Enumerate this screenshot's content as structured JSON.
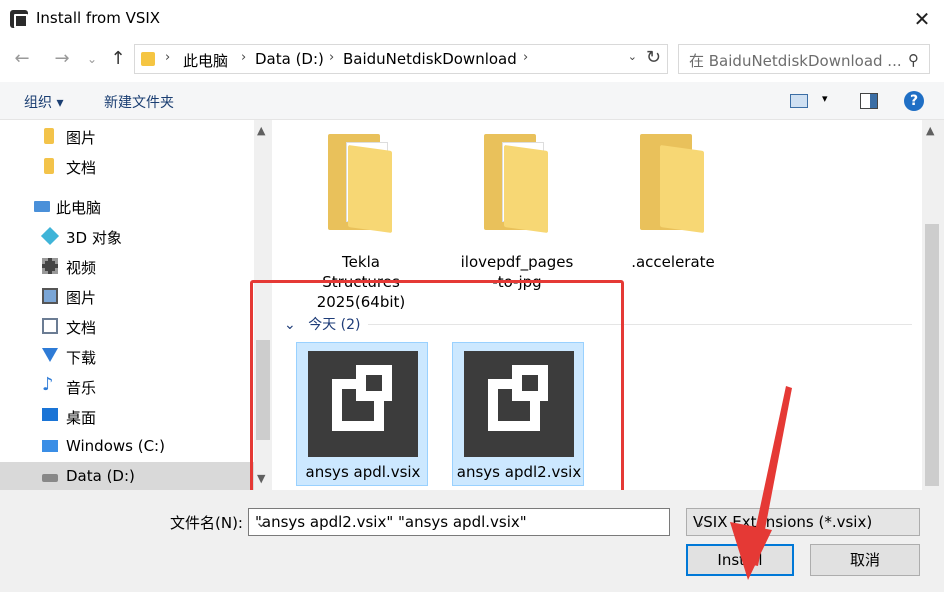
{
  "window": {
    "title": "Install from VSIX",
    "close_glyph": "✕"
  },
  "address": {
    "crumbs": [
      "此电脑",
      "Data (D:)",
      "BaiduNetdiskDownload"
    ],
    "search_placeholder": "在 BaiduNetdiskDownload ..."
  },
  "toolbar": {
    "organize": "组织 ▾",
    "new_folder": "新建文件夹",
    "help": "?"
  },
  "nav": {
    "items": [
      {
        "label": "图片",
        "icon": "folder-icon"
      },
      {
        "label": "文档",
        "icon": "folder-icon"
      },
      {
        "label": "此电脑",
        "icon": "pc-icon"
      },
      {
        "label": "3D 对象",
        "icon": "3d-objects-icon"
      },
      {
        "label": "视频",
        "icon": "video-icon"
      },
      {
        "label": "图片",
        "icon": "pictures-icon"
      },
      {
        "label": "文档",
        "icon": "documents-icon"
      },
      {
        "label": "下载",
        "icon": "download-icon"
      },
      {
        "label": "音乐",
        "icon": "music-icon"
      },
      {
        "label": "桌面",
        "icon": "desktop-icon"
      },
      {
        "label": "Windows (C:)",
        "icon": "windows-drive-icon"
      },
      {
        "label": "Data (D:)",
        "icon": "drive-icon"
      }
    ]
  },
  "folders": [
    {
      "line1": "Tekla",
      "line2": "Structures",
      "line3": "2025(64bit)"
    },
    {
      "line1": "ilovepdf_pages",
      "line2": "-to-jpg",
      "line3": ""
    },
    {
      "line1": ".accelerate",
      "line2": "",
      "line3": ""
    }
  ],
  "group": {
    "header": "今天 (2)"
  },
  "files": [
    {
      "label": "ansys apdl.vsix"
    },
    {
      "label": "ansys apdl2.vsix"
    }
  ],
  "footer": {
    "filename_label": "文件名(N):",
    "filename_value": "\"ansys apdl2.vsix\" \"ansys apdl.vsix\"",
    "filetype": "VSIX Extensions (*.vsix)",
    "install": "Install",
    "cancel": "取消"
  },
  "colors": {
    "highlight": "#e53935",
    "selection": "#cce8ff",
    "primary_border": "#0078d7"
  }
}
